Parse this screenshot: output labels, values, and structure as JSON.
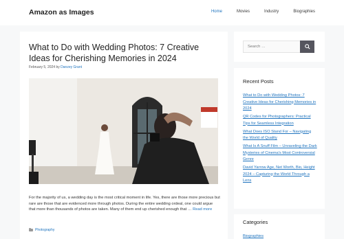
{
  "header": {
    "site_title": "Amazon as Images",
    "nav": [
      {
        "label": "Home",
        "active": true
      },
      {
        "label": "Movies",
        "active": false
      },
      {
        "label": "Industry",
        "active": false
      },
      {
        "label": "Biographies",
        "active": false
      }
    ]
  },
  "article": {
    "title": "What to Do with Wedding Photos: 7 Creative Ideas for Cherishing Memories in 2024",
    "date": "February 5, 2024",
    "by": "by",
    "author": "Danzey Grant",
    "excerpt": "For the majority of us, a wedding day is the most critical moment in life. Yes, there are those more precious but rare are those that are evidenced more through photos. During the entire wedding ordeal, one could argue that more than thousands of photos are taken. Many of them end up cherished enough that …",
    "read_more": "Read more",
    "category": "Photography",
    "image_icon": "wedding-photoshoot-image"
  },
  "sidebar": {
    "search": {
      "placeholder": "Search …",
      "icon": "search-icon"
    },
    "recent_title": "Recent Posts",
    "recent_posts": [
      "What to Do with Wedding Photos: 7 Creative Ideas for Cherishing Memories in 2024",
      "QR Codes for Photographers: Practical Tips for Seamless Integration",
      "What Does ISO Stand For – Navigating the World of Quality",
      "What Is A Snuff Film – Unraveling the Dark Mysteries of Cinema's Most Controversial Genre",
      "David Yarrow Age, Net Worth, Bio, Height 2024 – Capturing the World Through a Lens"
    ],
    "categories_title": "Categories",
    "categories": [
      "Biographies"
    ]
  },
  "colors": {
    "accent": "#1e73be",
    "background": "#f7f8f9",
    "search_button": "#55555e"
  }
}
